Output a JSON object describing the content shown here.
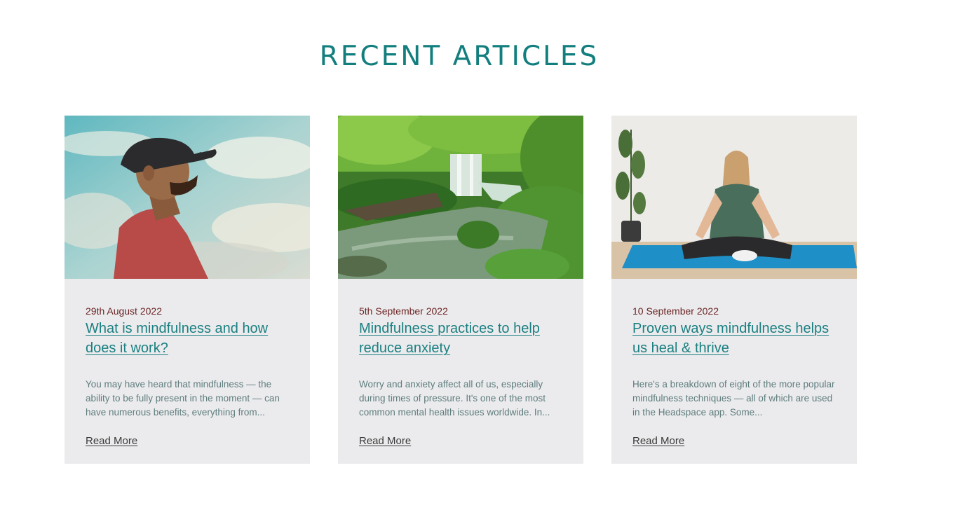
{
  "section": {
    "title": "RECENT ARTICLES"
  },
  "articles": [
    {
      "image_subject": "man in cap breathing under cloudy sky",
      "date": "29th August 2022",
      "title": "What is mindfulness and how does it work?",
      "excerpt": "You may have heard that mindfulness — the ability to be fully present in the moment — can have numerous benefits, everything from...",
      "read_more": "Read More"
    },
    {
      "image_subject": "forest waterfall with mossy stream",
      "date": "5th September 2022",
      "title": "Mindfulness practices to help reduce anxiety",
      "excerpt": "Worry and anxiety affect all of us, especially during times of pressure. It's one of the most common mental health issues worldwide. In...",
      "read_more": "Read More"
    },
    {
      "image_subject": "woman meditating on blue yoga mat",
      "date": "10 September 2022",
      "title": "Proven ways mindfulness helps us heal & thrive",
      "excerpt": "Here's a breakdown of eight of the more popular mindfulness techniques — all of which are used in the Headspace app. Some...",
      "read_more": "Read More"
    }
  ],
  "colors": {
    "accent": "#137e7e",
    "date": "#6b2424",
    "card_bg": "#ebebed"
  }
}
